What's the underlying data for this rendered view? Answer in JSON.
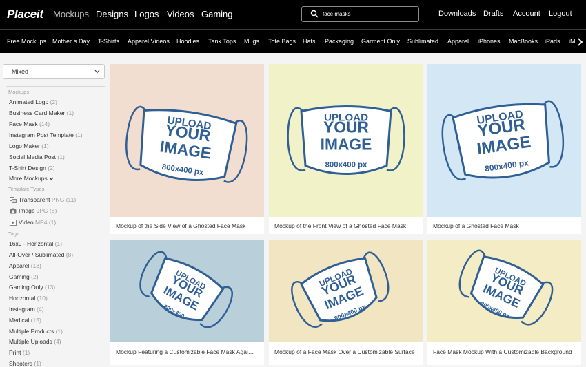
{
  "header": {
    "logo": "Placeit",
    "nav": [
      "Mockups",
      "Designs",
      "Logos",
      "Videos",
      "Gaming"
    ],
    "search_value": "face masks",
    "right_nav": [
      "Downloads",
      "Drafts",
      "Account",
      "Logout"
    ]
  },
  "categories": [
    "Free Mockups",
    "Mother´s Day",
    "T-Shirts",
    "Apparel Videos",
    "Hoodies",
    "Tank Tops",
    "Mugs",
    "Tote Bags",
    "Hats",
    "Packaging",
    "Garment Only",
    "Sublimated",
    "Apparel",
    "iPhones",
    "MacBooks",
    "iPads",
    "iM"
  ],
  "sidebar": {
    "sort_value": "Mixed",
    "mockups_head": "Mockups",
    "mockups": [
      {
        "label": "Animated Logo",
        "count": "(2)"
      },
      {
        "label": "Business Card Maker",
        "count": "(1)"
      },
      {
        "label": "Face Mask",
        "count": "(14)"
      },
      {
        "label": "Instagram Post Template",
        "count": "(1)"
      },
      {
        "label": "Logo Maker",
        "count": "(1)"
      },
      {
        "label": "Social Media Post",
        "count": "(1)"
      },
      {
        "label": "T-Shirt Design",
        "count": "(2)"
      }
    ],
    "more_mockups": "More Mockups",
    "types_head": "Template Types",
    "types": [
      {
        "label": "Transparent",
        "ext": "PNG",
        "count": "(11)"
      },
      {
        "label": "Image",
        "ext": "JPG",
        "count": "(8)"
      },
      {
        "label": "Video",
        "ext": "MP4",
        "count": "(1)"
      }
    ],
    "tags_head": "Tags",
    "tags": [
      {
        "label": "16x9 - Horizontal",
        "count": "(1)"
      },
      {
        "label": "All-Over / Sublimated",
        "count": "(8)"
      },
      {
        "label": "Apparel",
        "count": "(13)"
      },
      {
        "label": "Gaming",
        "count": "(2)"
      },
      {
        "label": "Gaming Only",
        "count": "(13)"
      },
      {
        "label": "Horizontal",
        "count": "(10)"
      },
      {
        "label": "Instagram",
        "count": "(4)"
      },
      {
        "label": "Medical",
        "count": "(15)"
      },
      {
        "label": "Multiple Products",
        "count": "(1)"
      },
      {
        "label": "Multiple Uploads",
        "count": "(4)"
      },
      {
        "label": "Print",
        "count": "(1)"
      },
      {
        "label": "Shooters",
        "count": "(1)"
      }
    ]
  },
  "cards": [
    {
      "caption": "Mockup of the Side View of a Ghosted Face Mask",
      "bg": "#f2ddd1",
      "mask_lines": [
        "UPLOAD",
        "YOUR",
        "IMAGE",
        "800x400 px"
      ]
    },
    {
      "caption": "Mockup of the Front View of a Ghosted Face Mask",
      "bg": "#f2f2c9",
      "mask_lines": [
        "UPLOAD",
        "YOUR",
        "IMAGE",
        "800x400 px"
      ]
    },
    {
      "caption": "Mockup of a Ghosted Face Mask",
      "bg": "#d3e7f4",
      "mask_lines": [
        "UPLOAD",
        "YOUR",
        "IMAGE",
        "800x400 px"
      ]
    },
    {
      "caption": "Mockup Featuring a Customizable Face Mask Agai…",
      "bg": "#b9d0da",
      "mask_lines": [
        "UPLOAD",
        "YOUR",
        "IMAGE",
        "800x400"
      ]
    },
    {
      "caption": "Mockup of a Face Mask Over a Customizable Surface",
      "bg": "#f1e6c1",
      "mask_lines": [
        "UPLOAD",
        "YOUR",
        "IMAGE",
        "800x400 px"
      ]
    },
    {
      "caption": "Face Mask Mockup With a Customizable Background",
      "bg": "#f4ecc4",
      "mask_lines": [
        "UPLOAD",
        "YOUR",
        "IMAGE",
        "800x400 px"
      ]
    }
  ],
  "colors": {
    "mask_trim": "#2f5f95",
    "mask_text": "#2f5f95",
    "mask_fill": "#ffffff"
  }
}
